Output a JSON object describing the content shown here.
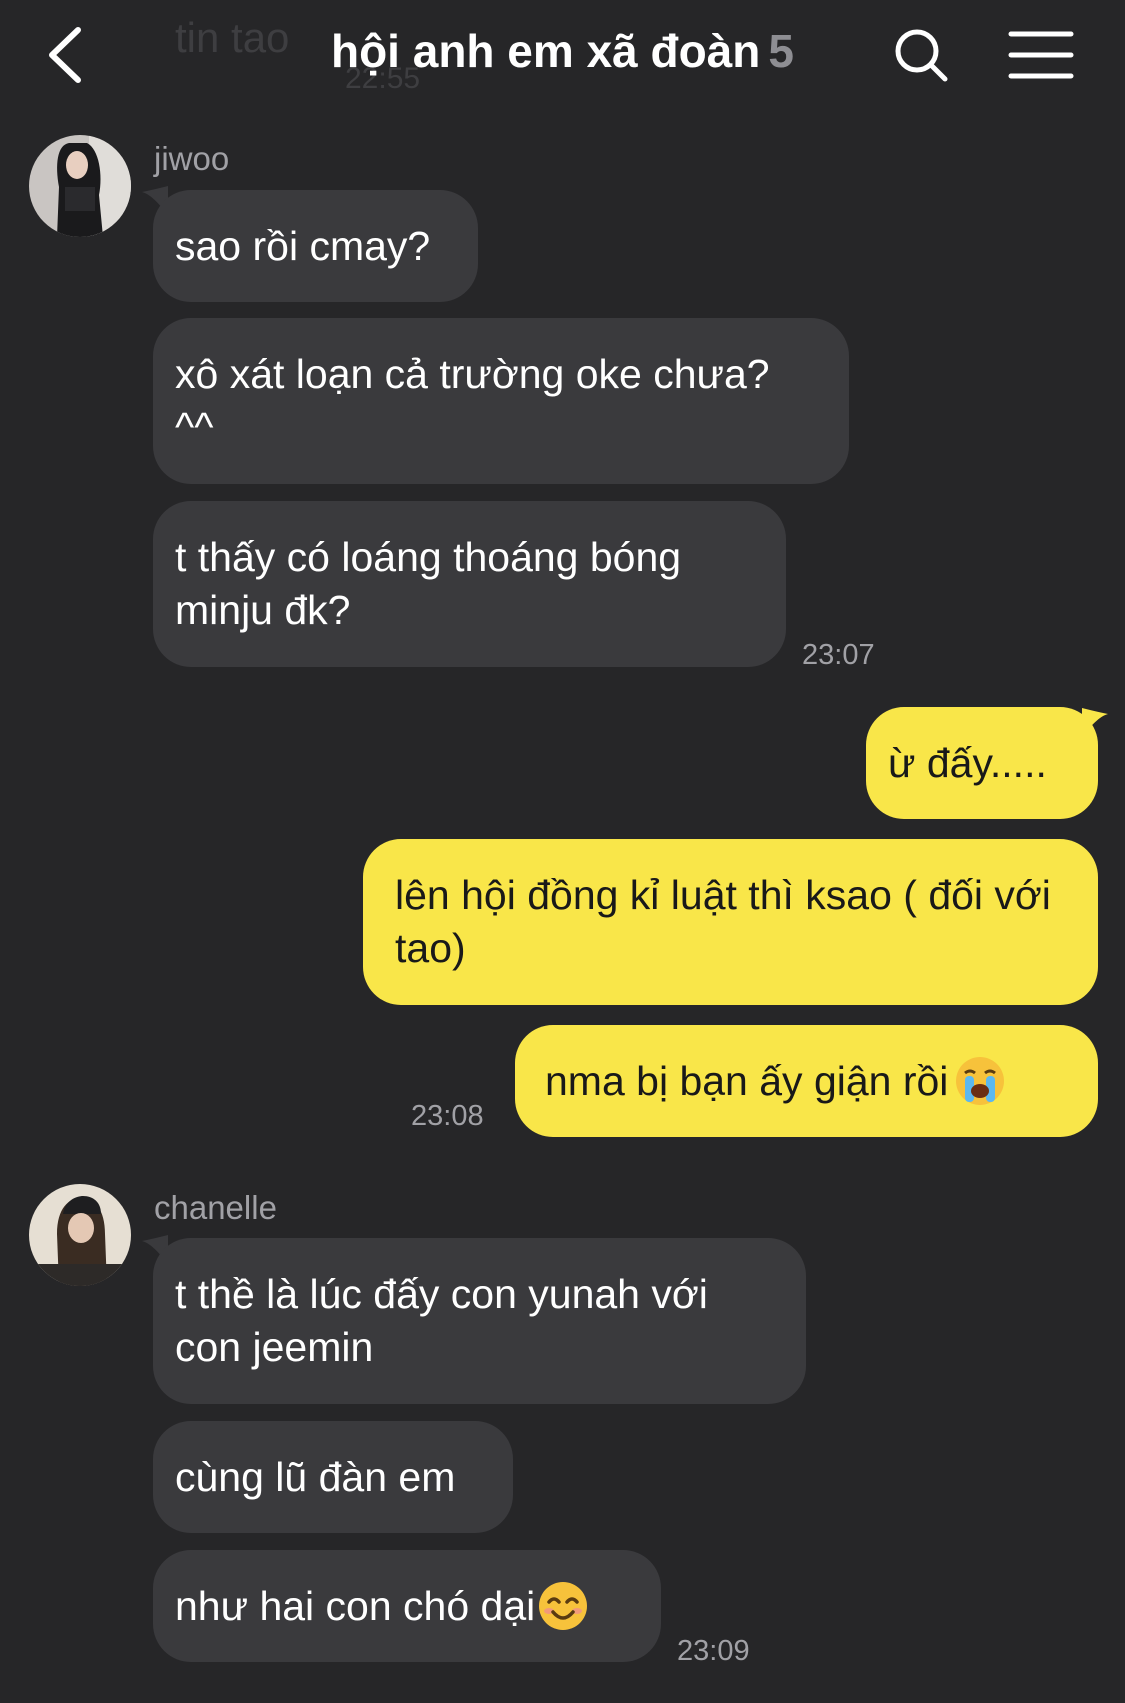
{
  "header": {
    "ghost_text": "tin tao",
    "ghost_time": "22:55",
    "title": "hội anh em xã đoàn",
    "member_count": "5"
  },
  "messages": {
    "jiwoo": {
      "sender": "jiwoo",
      "texts": [
        "sao rồi cmay?",
        "xô xát loạn cả trường oke chưa? ^^",
        "t thấy có loáng thoáng bóng minju đk?"
      ],
      "time": "23:07"
    },
    "me": {
      "texts": [
        "ừ đấy.....",
        "lên hội đồng kỉ luật thì ksao ( đối với tao)",
        "nma bị bạn ấy giận rồi"
      ],
      "time": "23:08"
    },
    "chanelle": {
      "sender": "chanelle",
      "texts": [
        "t thề là lúc đấy con yunah với con jeemin",
        "cùng lũ đàn em",
        "như hai con chó dại"
      ],
      "time": "23:09"
    }
  },
  "icons": {
    "back": "chevron-left-icon",
    "search": "search-icon",
    "menu": "hamburger-menu-icon",
    "crying": "loudly-crying-face-emoji",
    "smile": "smiling-face-emoji"
  },
  "colors": {
    "background": "#262628",
    "incoming_bubble": "#3a3a3d",
    "outgoing_bubble": "#f9e649",
    "meta_text": "#a1a1a6"
  }
}
